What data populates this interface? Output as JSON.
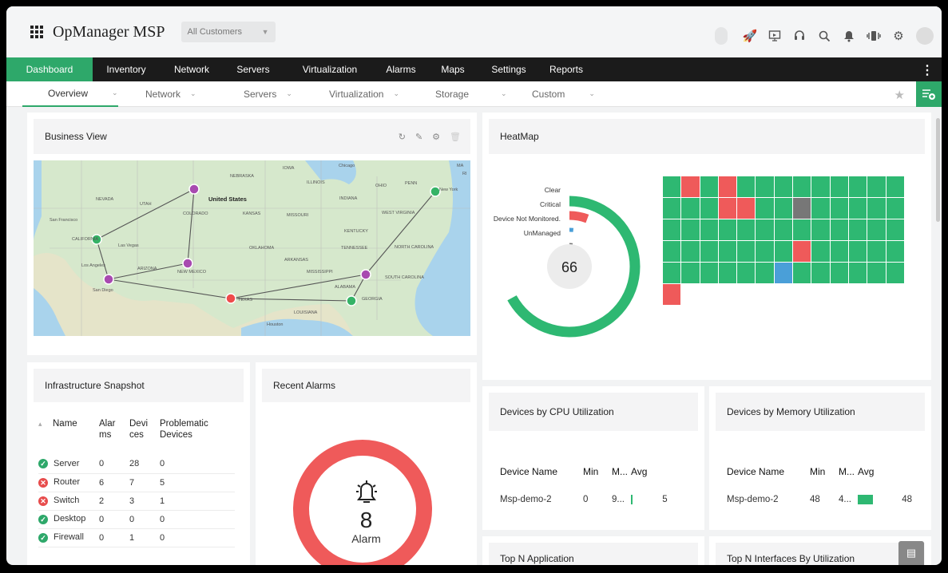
{
  "app": {
    "title": "OpManager MSP",
    "customer_select": "All Customers"
  },
  "nav": [
    "Dashboard",
    "Inventory",
    "Network",
    "Servers",
    "Virtualization",
    "Alarms",
    "Maps",
    "Settings",
    "Reports"
  ],
  "subnav": [
    "Overview",
    "Network",
    "Servers",
    "Virtualization",
    "Storage",
    "Custom"
  ],
  "business_view": {
    "title": "Business View",
    "map_labels": [
      "United States",
      "NEBRASKA",
      "IOWA",
      "Chicago",
      "ILLINOIS",
      "OHIO",
      "PENN",
      "New York",
      "NEVADA",
      "UTAH",
      "COLORADO",
      "KANSAS",
      "MISSOURI",
      "INDIANA",
      "WEST VIRGINIA",
      "KENTUCKY",
      "San Francisco",
      "CALIFORNIA",
      "Las Vegas",
      "OKLAHOMA",
      "ARKANSAS",
      "TENNESSEE",
      "NORTH CAROLINA",
      "Los Angeles",
      "ARIZONA",
      "NEW MEXICO",
      "MISSISSIPPI",
      "SOUTH CAROLINA",
      "San Diego",
      "TEXAS",
      "ALABAMA",
      "GEORGIA",
      "LOUISIANA",
      "Houston",
      "MA",
      "RI"
    ]
  },
  "heatmap": {
    "title": "HeatMap",
    "total": "66",
    "legend": [
      "Clear",
      "Critical",
      "Device Not Monitored.",
      "UnManaged"
    ],
    "colors": {
      "clear": "#2eb872",
      "critical": "#ef5a5a",
      "not_monitored": "#4a9fd8",
      "unmanaged": "#777777"
    },
    "counts": {
      "clear": 59,
      "critical": 5,
      "not_monitored": 1,
      "unmanaged": 1
    },
    "cells": [
      "g",
      "r",
      "g",
      "r",
      "g",
      "g",
      "g",
      "g",
      "g",
      "g",
      "g",
      "g",
      "g",
      "g",
      "g",
      "g",
      "r",
      "r",
      "g",
      "g",
      "u",
      "g",
      "g",
      "g",
      "g",
      "g",
      "g",
      "g",
      "g",
      "g",
      "g",
      "g",
      "g",
      "g",
      "g",
      "g",
      "g",
      "g",
      "g",
      "g",
      "g",
      "g",
      "g",
      "g",
      "g",
      "g",
      "r",
      "g",
      "g",
      "g",
      "g",
      "g",
      "g",
      "g",
      "g",
      "g",
      "g",
      "g",
      "b",
      "g",
      "g",
      "g",
      "g",
      "g",
      "g",
      "r"
    ]
  },
  "snapshot": {
    "title": "Infrastructure Snapshot",
    "headers": [
      "Name",
      "Alar ms",
      "Devi ces",
      "Problematic Devices"
    ],
    "rows": [
      {
        "name": "Server",
        "status": "ok",
        "alarms": "0",
        "devices": "28",
        "problematic": "0"
      },
      {
        "name": "Router",
        "status": "bad",
        "alarms": "6",
        "devices": "7",
        "problematic": "5"
      },
      {
        "name": "Switch",
        "status": "bad",
        "alarms": "2",
        "devices": "3",
        "problematic": "1"
      },
      {
        "name": "Desktop",
        "status": "ok",
        "alarms": "0",
        "devices": "0",
        "problematic": "0"
      },
      {
        "name": "Firewall",
        "status": "ok",
        "alarms": "0",
        "devices": "1",
        "problematic": "0"
      }
    ]
  },
  "recent_alarms": {
    "title": "Recent Alarms",
    "count": "8",
    "label": "Alarm",
    "color": "#ef5a5a"
  },
  "cpu": {
    "title": "Devices by CPU Utilization",
    "headers": [
      "Device Name",
      "Min",
      "M...",
      "Avg"
    ],
    "row": {
      "device": "Msp-demo-2",
      "min": "0",
      "max": "9...",
      "avg": "5",
      "avg_percent": 5
    }
  },
  "memory": {
    "title": "Devices by Memory Utilization",
    "headers": [
      "Device Name",
      "Min",
      "M...",
      "Avg"
    ],
    "row": {
      "device": "Msp-demo-2",
      "min": "48",
      "max": "4...",
      "avg": "48",
      "avg_percent": 48
    }
  },
  "bottom": {
    "top_app": "Top N Application",
    "top_iface": "Top N Interfaces By Utilization"
  }
}
